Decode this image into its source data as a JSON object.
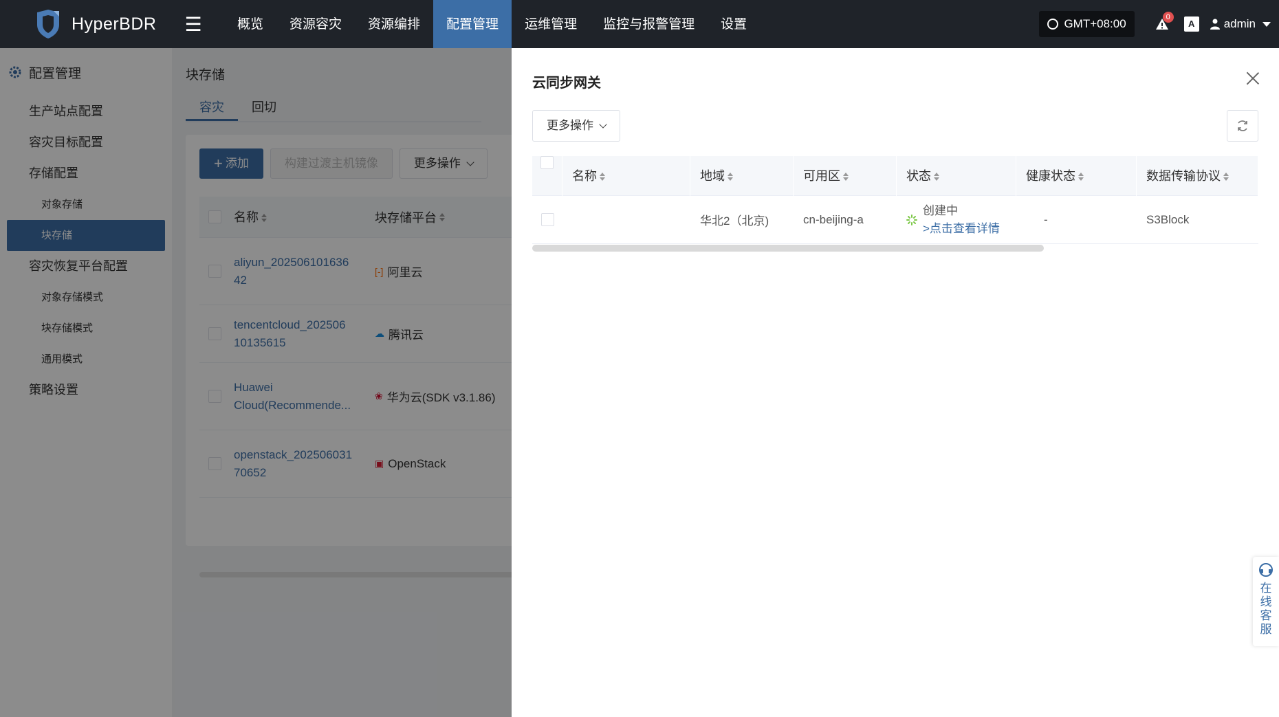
{
  "app": {
    "name": "HyperBDR"
  },
  "nav": {
    "items": [
      {
        "label": "概览",
        "active": false
      },
      {
        "label": "资源容灾",
        "active": false
      },
      {
        "label": "资源编排",
        "active": false
      },
      {
        "label": "配置管理",
        "active": true
      },
      {
        "label": "运维管理",
        "active": false
      },
      {
        "label": "监控与报警管理",
        "active": false
      },
      {
        "label": "设置",
        "active": false
      }
    ],
    "timezone": "GMT+08:00",
    "alert_count": "0",
    "lang_icon": "A",
    "user": "admin"
  },
  "sidebar": {
    "title": "配置管理",
    "items": [
      {
        "label": "生产站点配置",
        "level": 1
      },
      {
        "label": "容灾目标配置",
        "level": 1
      },
      {
        "label": "存储配置",
        "level": 1
      },
      {
        "label": "对象存储",
        "level": 2
      },
      {
        "label": "块存储",
        "level": 2,
        "active": true
      },
      {
        "label": "容灾恢复平台配置",
        "level": 1
      },
      {
        "label": "对象存储模式",
        "level": 2
      },
      {
        "label": "块存储模式",
        "level": 2
      },
      {
        "label": "通用模式",
        "level": 2
      },
      {
        "label": "策略设置",
        "level": 1
      }
    ]
  },
  "page": {
    "title": "块存储",
    "tabs": [
      {
        "label": "容灾",
        "active": true
      },
      {
        "label": "回切",
        "active": false
      }
    ],
    "toolbar": {
      "add": "添加",
      "build_image": "构建过渡主机镜像",
      "more": "更多操作"
    },
    "table": {
      "columns": {
        "name": "名称",
        "platform": "块存储平台"
      },
      "rows": [
        {
          "name": "aliyun_20250610163642",
          "name_l1": "aliyun_202506101636",
          "name_l2": "42",
          "platform": "阿里云",
          "icon": "aliyun-icon",
          "icon_glyph": "[-]",
          "icon_color": "#ff6a00"
        },
        {
          "name": "tencentcloud_20250610135615",
          "name_l1": "tencentcloud_202506",
          "name_l2": "10135615",
          "platform": "腾讯云",
          "icon": "tencent-cloud-icon",
          "icon_glyph": "☁",
          "icon_color": "#1a8fdf"
        },
        {
          "name": "Huawei Cloud(Recommende...",
          "name_l1": "Huawei",
          "name_l2": "Cloud(Recommende...",
          "platform": "华为云(SDK v3.1.86)",
          "icon": "huawei-icon",
          "icon_glyph": "❀",
          "icon_color": "#cf0a2c"
        },
        {
          "name": "openstack_20250603170652",
          "name_l1": "openstack_202506031",
          "name_l2": "70652",
          "platform": "OpenStack",
          "icon": "openstack-icon",
          "icon_glyph": "▣",
          "icon_color": "#da1a32"
        }
      ]
    }
  },
  "drawer": {
    "title": "云同步网关",
    "more": "更多操作",
    "columns": {
      "name": "名称",
      "region": "地域",
      "zone": "可用区",
      "status": "状态",
      "health": "健康状态",
      "protocol": "数据传输协议"
    },
    "rows": [
      {
        "name": "",
        "region": "华北2（北京)",
        "zone": "cn-beijing-a",
        "status": "创建中",
        "status_link": ">点击查看详情",
        "health": "-",
        "protocol": "S3Block"
      }
    ]
  },
  "support": {
    "label": "在线客服"
  },
  "colors": {
    "brand": "#3c6ea6",
    "topbar": "#1f2329",
    "spinner": "#7ec84a"
  }
}
